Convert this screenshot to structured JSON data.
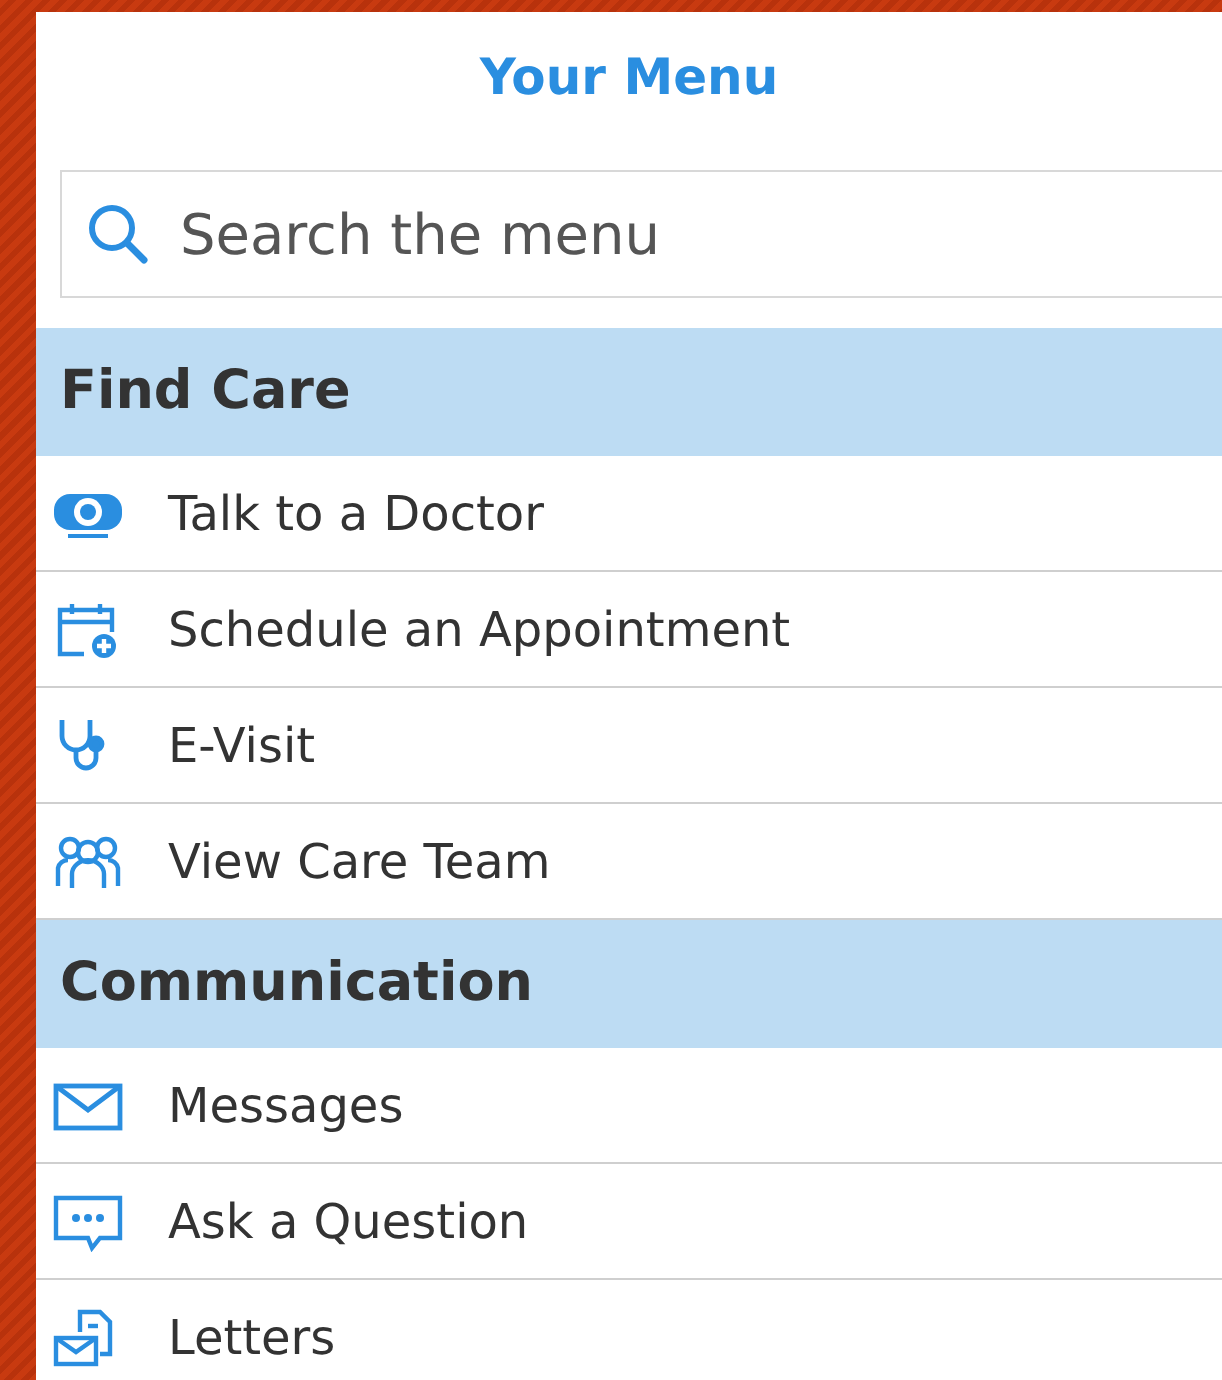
{
  "title": "Your Menu",
  "search": {
    "placeholder": "Search the menu"
  },
  "sections": [
    {
      "title": "Find Care",
      "items": [
        {
          "label": "Talk to a Doctor"
        },
        {
          "label": "Schedule an Appointment"
        },
        {
          "label": "E-Visit"
        },
        {
          "label": "View Care Team"
        }
      ]
    },
    {
      "title": "Communication",
      "items": [
        {
          "label": "Messages"
        },
        {
          "label": "Ask a Question"
        },
        {
          "label": "Letters"
        }
      ]
    }
  ]
}
